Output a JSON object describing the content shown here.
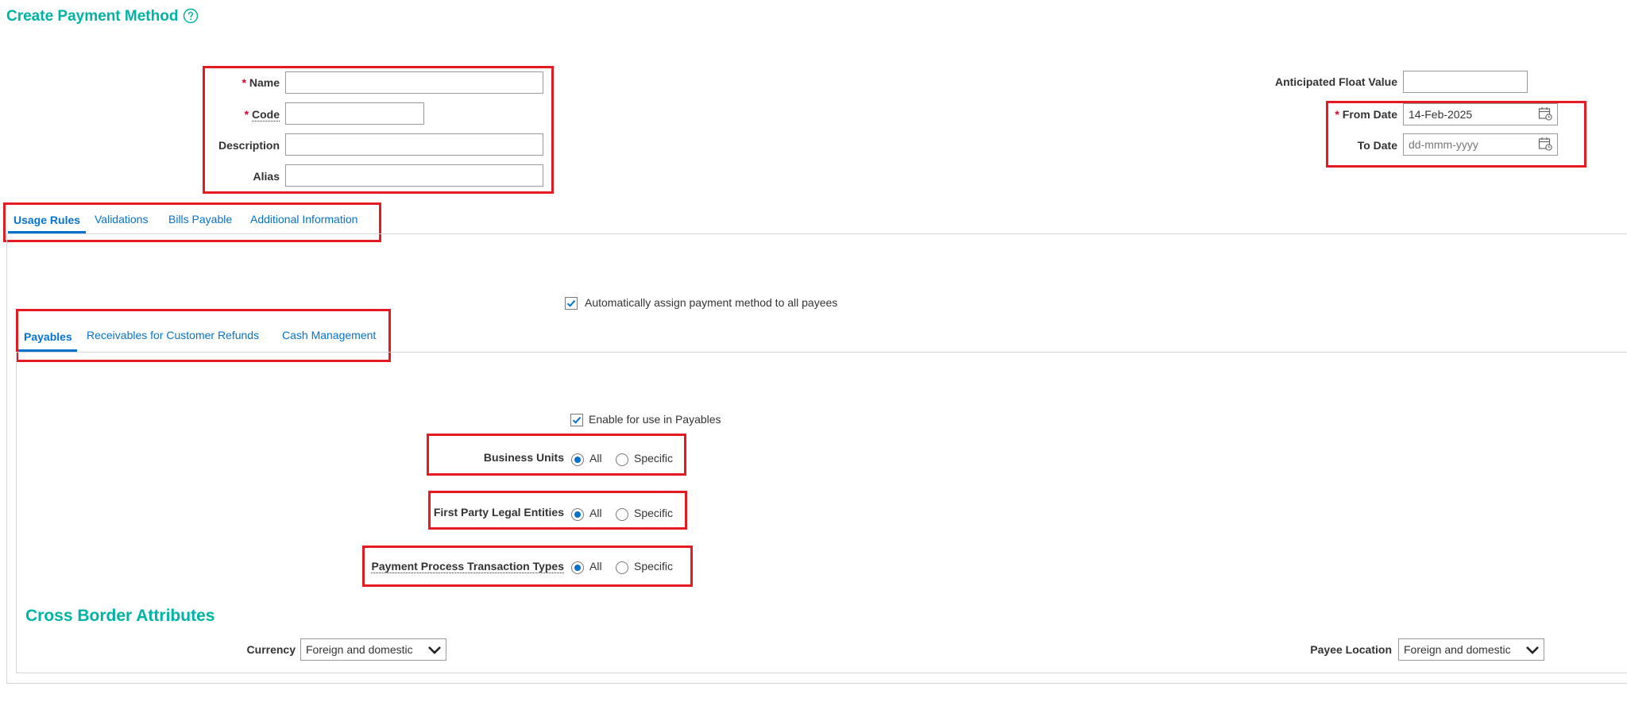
{
  "page": {
    "title": "Create Payment Method"
  },
  "header_form": {
    "name": {
      "label": "Name",
      "value": "",
      "required": "*"
    },
    "code": {
      "label": "Code",
      "value": "",
      "required": "*"
    },
    "description": {
      "label": "Description",
      "value": ""
    },
    "alias": {
      "label": "Alias",
      "value": ""
    },
    "anticipated_float_value": {
      "label": "Anticipated Float Value",
      "value": ""
    },
    "from_date": {
      "label": "From Date",
      "value": "14-Feb-2025",
      "required": "*"
    },
    "to_date": {
      "label": "To Date",
      "value": "",
      "placeholder": "dd-mmm-yyyy"
    }
  },
  "main_tabs": [
    {
      "label": "Usage Rules",
      "selected": true
    },
    {
      "label": "Validations"
    },
    {
      "label": "Bills Payable"
    },
    {
      "label": "Additional Information"
    }
  ],
  "usage_rules": {
    "auto_assign": {
      "label": "Automatically assign payment method to all payees",
      "checked": true
    }
  },
  "sub_tabs": [
    {
      "label": "Payables",
      "selected": true
    },
    {
      "label": "Receivables for Customer Refunds"
    },
    {
      "label": "Cash Management"
    }
  ],
  "payables": {
    "enable": {
      "label": "Enable for use in Payables",
      "checked": true
    },
    "business_units": {
      "label": "Business Units",
      "options": [
        "All",
        "Specific"
      ],
      "selected": "All"
    },
    "first_party_legal_entities": {
      "label": "First Party Legal Entities",
      "options": [
        "All",
        "Specific"
      ],
      "selected": "All"
    },
    "payment_process_transaction_types": {
      "label": "Payment Process Transaction Types",
      "options": [
        "All",
        "Specific"
      ],
      "selected": "All"
    }
  },
  "cross_border": {
    "title": "Cross Border Attributes",
    "currency": {
      "label": "Currency",
      "value": "Foreign and domestic"
    },
    "payee_location": {
      "label": "Payee Location",
      "value": "Foreign and domestic"
    }
  },
  "colors": {
    "accent": "#00b4a5",
    "link": "#0572ce",
    "highlight": "#e41b23",
    "required": "#e0002a"
  },
  "icons": {
    "help": "help-icon",
    "calendar": "calendar-icon",
    "dropdown": "chevron-down-icon",
    "checkbox": "check-icon"
  }
}
